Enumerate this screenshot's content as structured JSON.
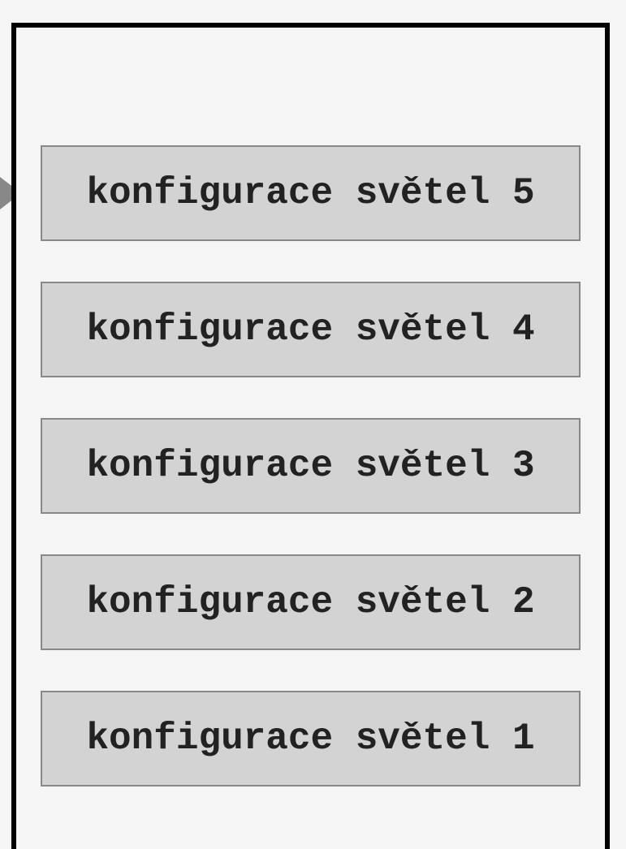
{
  "menu": {
    "items": [
      {
        "label": "konfigurace světel 5",
        "selected": true
      },
      {
        "label": "konfigurace světel 4",
        "selected": false
      },
      {
        "label": "konfigurace světel 3",
        "selected": false
      },
      {
        "label": "konfigurace světel 2",
        "selected": false
      },
      {
        "label": "konfigurace světel 1",
        "selected": false
      }
    ]
  }
}
